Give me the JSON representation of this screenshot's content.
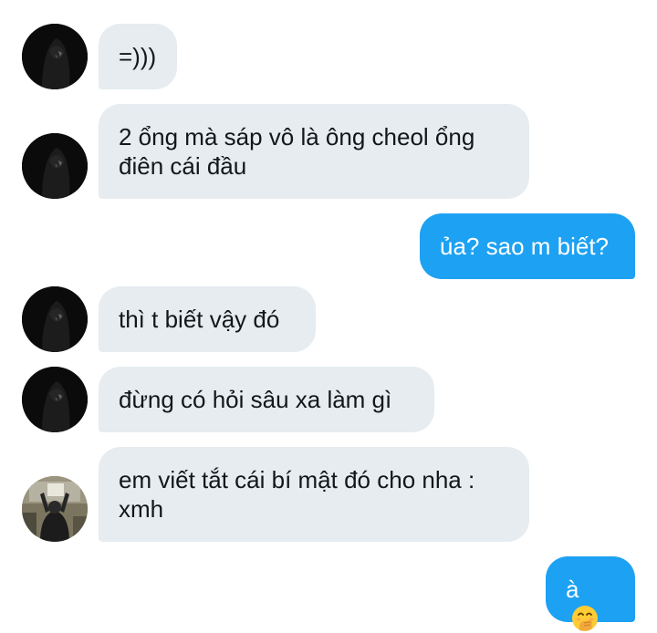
{
  "conversation": {
    "messages": [
      {
        "side": "in",
        "text": "=)))",
        "avatar": "dark-profile-avatar"
      },
      {
        "side": "in",
        "text": "2 ổng mà sáp vô là ông cheol ổng điên cái đầu",
        "avatar": "dark-profile-avatar"
      },
      {
        "side": "out",
        "text": "ủa? sao m biết?"
      },
      {
        "side": "in",
        "text": "thì t biết vậy đó",
        "avatar": "dark-profile-avatar"
      },
      {
        "side": "in",
        "text": "đừng có hỏi sâu xa làm gì",
        "avatar": "dark-profile-avatar"
      },
      {
        "side": "in",
        "text": "em viết tắt cái bí mật đó cho nha : xmh",
        "avatar": "photo-avatar"
      },
      {
        "side": "out",
        "text": "à",
        "emoji": "hand-over-mouth-emoji"
      }
    ]
  },
  "colors": {
    "incoming_bubble": "#e6ecf0",
    "outgoing_bubble": "#1da1f2",
    "incoming_text": "#14171a",
    "outgoing_text": "#ffffff"
  }
}
